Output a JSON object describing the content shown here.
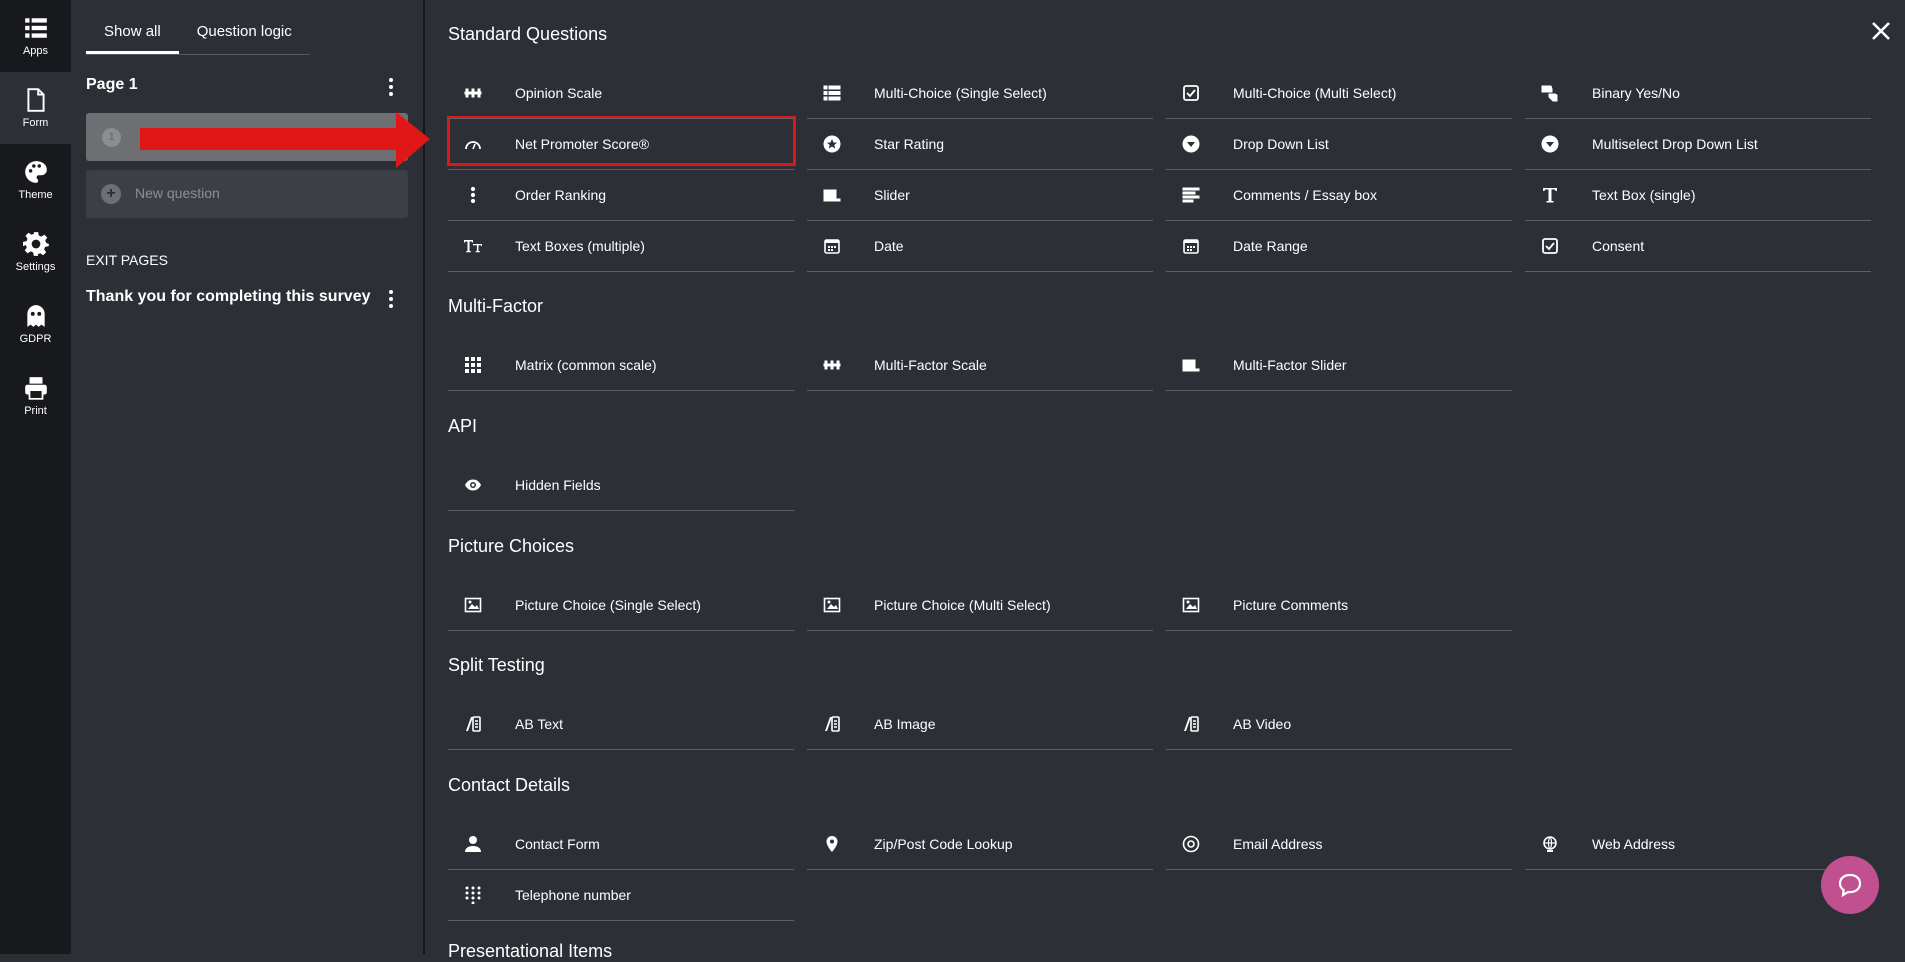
{
  "rail": {
    "items": [
      {
        "label": "Apps",
        "icon": "apps-icon"
      },
      {
        "label": "Form",
        "icon": "form-icon"
      },
      {
        "label": "Theme",
        "icon": "palette-icon"
      },
      {
        "label": "Settings",
        "icon": "gear-icon"
      },
      {
        "label": "GDPR",
        "icon": "ghost-icon"
      },
      {
        "label": "Print",
        "icon": "printer-icon"
      }
    ]
  },
  "panel": {
    "tabs": [
      "Show all",
      "Question logic"
    ],
    "page_title": "Page 1",
    "selected_question_number": "1",
    "new_question": "New question",
    "exit_pages": "EXIT PAGES",
    "thank_you": "Thank you for completing this survey"
  },
  "sections": [
    {
      "title": "Standard Questions",
      "items": [
        "Opinion Scale",
        "Multi-Choice (Single Select)",
        "Multi-Choice (Multi Select)",
        "Binary Yes/No",
        "Net Promoter Score®",
        "Star Rating",
        "Drop Down List",
        "Multiselect Drop Down List",
        "Order Ranking",
        "Slider",
        "Comments / Essay box",
        "Text Box (single)",
        "Text Boxes (multiple)",
        "Date",
        "Date Range",
        "Consent"
      ]
    },
    {
      "title": "Multi-Factor",
      "items": [
        "Matrix (common scale)",
        "Multi-Factor Scale",
        "Multi-Factor Slider"
      ]
    },
    {
      "title": "API",
      "items": [
        "Hidden Fields"
      ]
    },
    {
      "title": "Picture Choices",
      "items": [
        "Picture Choice (Single Select)",
        "Picture Choice (Multi Select)",
        "Picture Comments"
      ]
    },
    {
      "title": "Split Testing",
      "items": [
        "AB Text",
        "AB Image",
        "AB Video"
      ]
    },
    {
      "title": "Contact Details",
      "items": [
        "Contact Form",
        "Zip/Post Code Lookup",
        "Email Address",
        "Web Address",
        "Telephone number"
      ]
    },
    {
      "title": "Presentational Items",
      "items": []
    }
  ],
  "colors": {
    "highlight": "#e11717",
    "help_button": "#c0508f"
  }
}
